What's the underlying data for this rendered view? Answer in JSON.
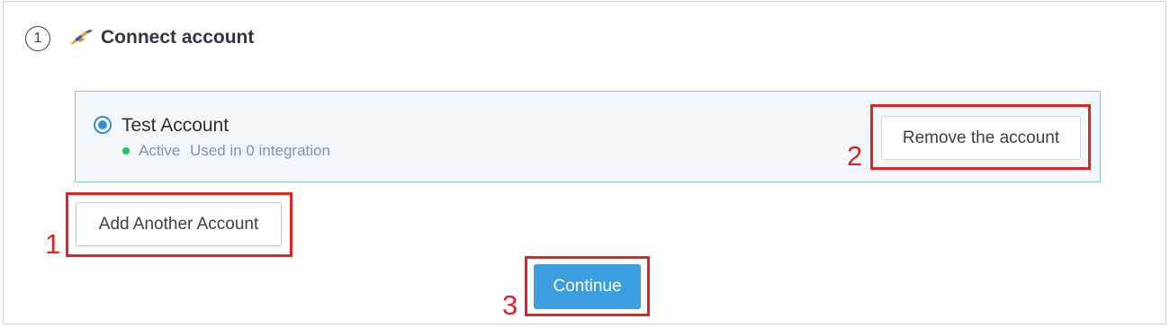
{
  "step": {
    "number": "1",
    "title": "Connect account"
  },
  "account": {
    "name": "Test Account",
    "status": "Active",
    "usage": "Used in 0 integration",
    "status_color": "#22c55e"
  },
  "buttons": {
    "remove": "Remove the account",
    "add": "Add Another Account",
    "continue": "Continue"
  },
  "annotations": [
    "1",
    "2",
    "3"
  ],
  "colors": {
    "accent": "#3a9ee0",
    "highlight": "#e02424",
    "account_bg": "#f1f7fa"
  }
}
